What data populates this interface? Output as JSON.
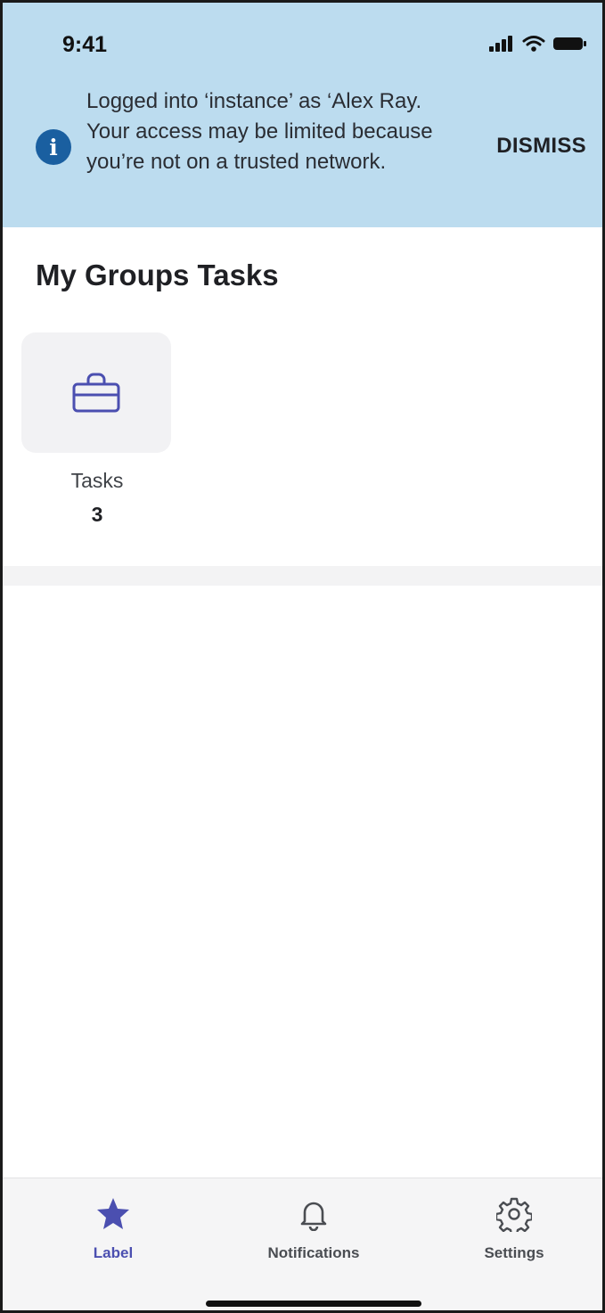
{
  "status_bar": {
    "time": "9:41"
  },
  "banner": {
    "info_icon": "info-icon",
    "message": "Logged into ‘instance’ as ‘Alex Ray. Your access may be limited because you’re not on a trusted network.",
    "dismiss_label": "DISMISS",
    "background": "#bcdcef"
  },
  "section": {
    "title": "My Groups Tasks",
    "card": {
      "icon": "briefcase-icon",
      "label": "Tasks",
      "count": "3"
    }
  },
  "tab_bar": {
    "items": [
      {
        "label": "Label",
        "icon": "star-icon",
        "active": true
      },
      {
        "label": "Notifications",
        "icon": "bell-icon",
        "active": false
      },
      {
        "label": "Settings",
        "icon": "gear-icon",
        "active": false
      }
    ]
  },
  "colors": {
    "accent": "#4b4fb0",
    "info": "#1a5fa0"
  }
}
